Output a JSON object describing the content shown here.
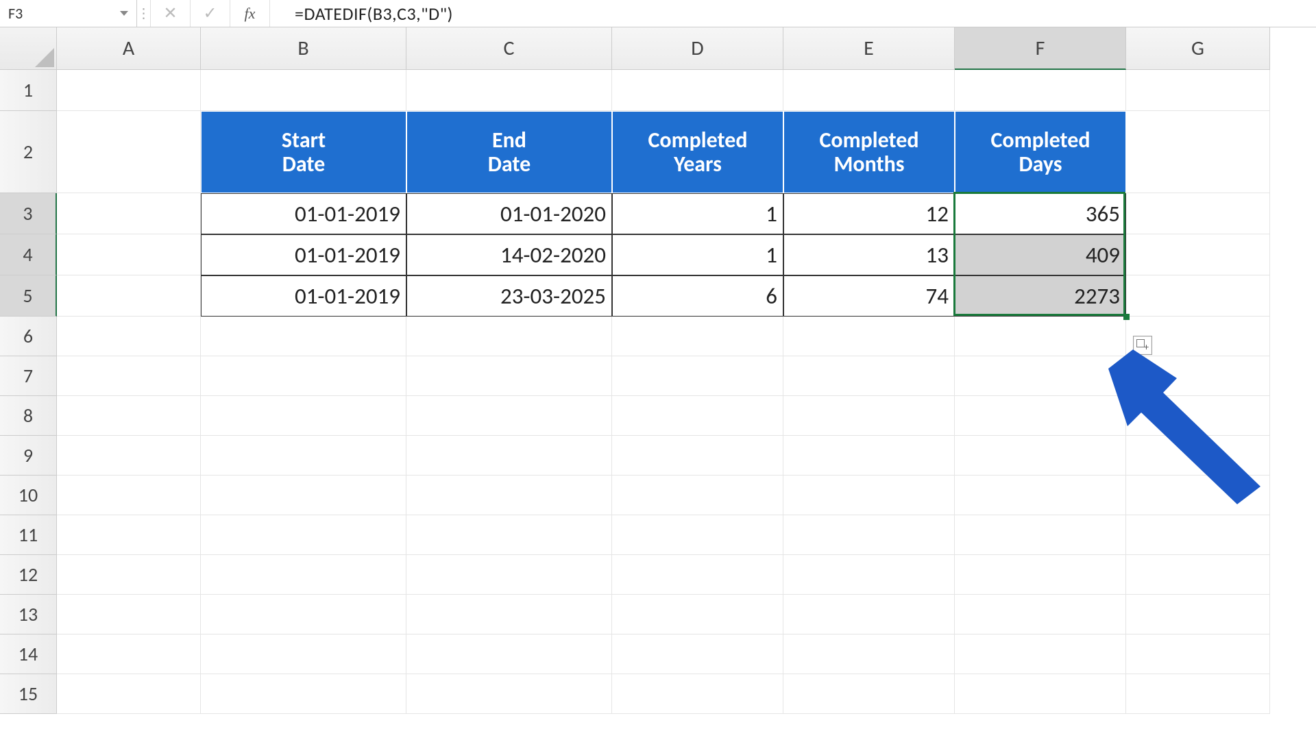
{
  "namebox": "F3",
  "formula": "=DATEDIF(B3,C3,\"D\")",
  "fb_icons": {
    "cancel": "✕",
    "enter": "✓",
    "fx": "fx",
    "dots": "⋮"
  },
  "columns": [
    "A",
    "B",
    "C",
    "D",
    "E",
    "F",
    "G"
  ],
  "rows": [
    "1",
    "2",
    "3",
    "4",
    "5",
    "6",
    "7",
    "8",
    "9",
    "10",
    "11",
    "12",
    "13",
    "14",
    "15"
  ],
  "selected_col": "F",
  "selected_rows": [
    "3",
    "4",
    "5"
  ],
  "table": {
    "headers": {
      "B": "Start Date",
      "C": "End Date",
      "D": "Completed Years",
      "E": "Completed Months",
      "F": "Completed Days"
    },
    "rows": [
      {
        "B": "01-01-2019",
        "C": "01-01-2020",
        "D": "1",
        "E": "12",
        "F": "365"
      },
      {
        "B": "01-01-2019",
        "C": "14-02-2020",
        "D": "1",
        "E": "13",
        "F": "409"
      },
      {
        "B": "01-01-2019",
        "C": "23-03-2025",
        "D": "6",
        "E": "74",
        "F": "2273"
      }
    ],
    "filled_cells": [
      "F4",
      "F5"
    ]
  },
  "colors": {
    "header_blue": "#1f6fd0",
    "arrow_blue": "#1d59c7",
    "selection_green": "#1a7a3c"
  }
}
